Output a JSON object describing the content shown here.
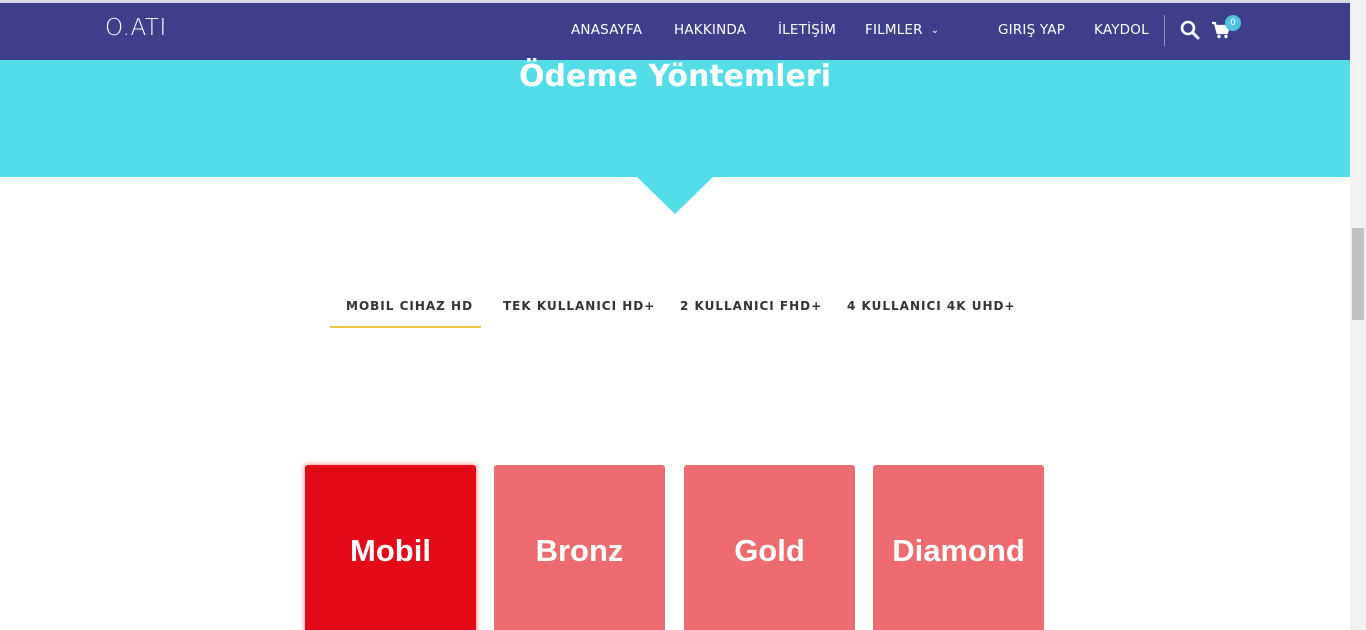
{
  "nav": {
    "logo": "O.ATI",
    "items": [
      {
        "label": "ANASAYFA"
      },
      {
        "label": "HAKKINDA"
      },
      {
        "label": "İLETİŞİM"
      },
      {
        "label": "FILMLER"
      }
    ],
    "login": "GIRIŞ YAP",
    "register": "KAYDOL",
    "cart_count": "0",
    "icons": [
      "search-icon",
      "cart-icon",
      "chevron-down-icon"
    ]
  },
  "hero": {
    "title": "Ödeme Yöntemleri"
  },
  "tabs": [
    {
      "label": "MOBIL CIHAZ HD",
      "active": true
    },
    {
      "label": "TEK KULLANICI HD+"
    },
    {
      "label": "2 KULLANICI FHD+"
    },
    {
      "label": "4 KULLANICI 4K UHD+"
    }
  ],
  "cards": [
    {
      "label": "Mobil",
      "active": true
    },
    {
      "label": "Bronz"
    },
    {
      "label": "Gold"
    },
    {
      "label": "Diamond"
    }
  ],
  "colors": {
    "navbar": "#3e3e8a",
    "hero": "#52dde9",
    "tab_underline": "#f0c542",
    "card_active": "#e30916",
    "card_inactive": "#ee6b6f"
  }
}
